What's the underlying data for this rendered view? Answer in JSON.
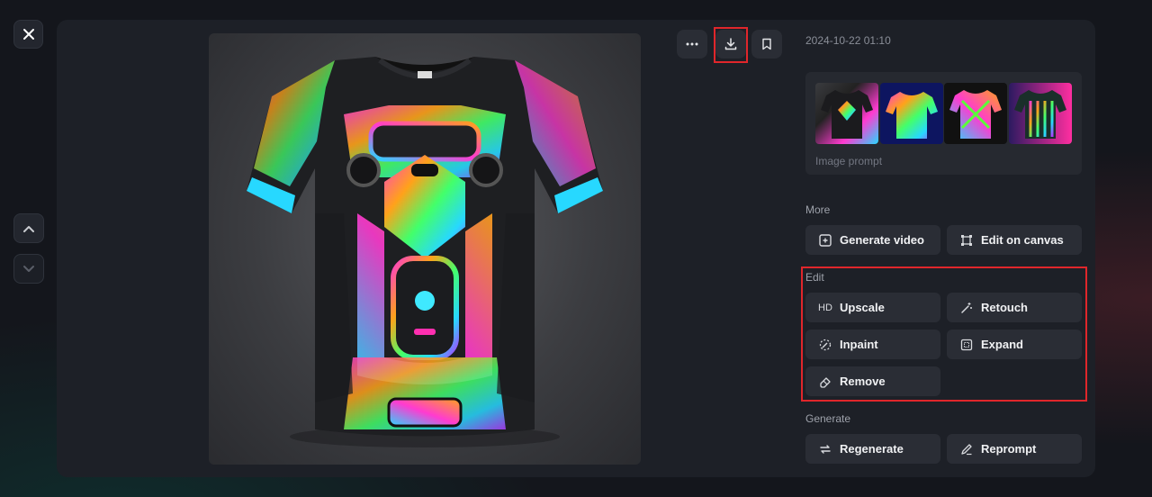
{
  "timestamp": "2024-10-22 01:10",
  "image_prompt_label": "Image prompt",
  "sections": {
    "more": "More",
    "edit": "Edit",
    "generate": "Generate"
  },
  "actions": {
    "generate_video": "Generate video",
    "edit_on_canvas": "Edit on canvas",
    "upscale": "Upscale",
    "upscale_prefix": "HD",
    "retouch": "Retouch",
    "inpaint": "Inpaint",
    "expand": "Expand",
    "remove": "Remove",
    "regenerate": "Regenerate",
    "reprompt": "Reprompt"
  },
  "icons": {
    "close": "close-icon",
    "up": "chevron-up-icon",
    "down": "chevron-down-icon",
    "more": "more-icon",
    "download": "download-icon",
    "bookmark": "bookmark-icon"
  },
  "colors": {
    "highlight": "#e0262b",
    "panel": "#1d2027",
    "button": "#2a2d35"
  }
}
